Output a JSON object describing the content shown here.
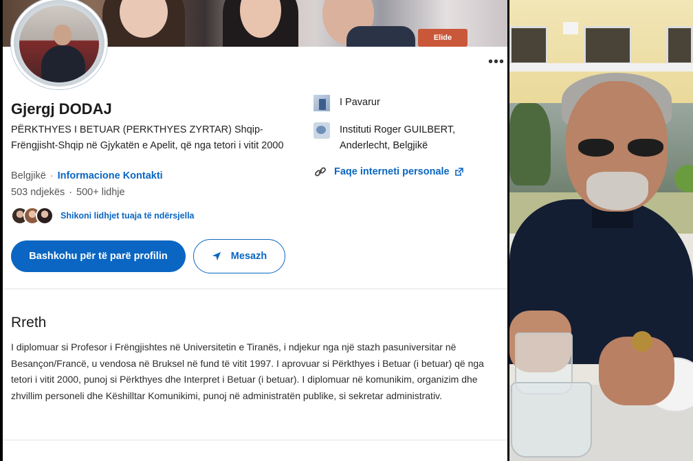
{
  "profile": {
    "name": "Gjergj DODAJ",
    "headline": "PËRKTHYES I BETUAR (PERKTHYES ZYRTAR) Shqip-Frëngjisht-Shqip në Gjykatën e Apelit, që nga tetori i vitit 2000",
    "location": "Belgjikë",
    "contact_link": "Informacione Kontakti",
    "followers": "503 ndjekës",
    "connections": "500+ lidhje",
    "mutual_text": "Shikoni lidhjet tuaja të ndërsjella",
    "more_label": "•••"
  },
  "actions": {
    "join_label": "Bashkohu për të parë profilin",
    "message_label": "Mesazh"
  },
  "cover": {
    "tag": "Elide"
  },
  "side_info": {
    "company": "I Pavarur",
    "school": "Instituti Roger GUILBERT, Anderlecht, Belgjikë",
    "website": "Faqe interneti personale"
  },
  "about": {
    "title": "Rreth",
    "text": "I diplomuar si Profesor i Frëngjishtes në Universitetin e Tiranës, i ndjekur nga një stazh pasuniversitar në Besançon/Francë, u vendosa në Bruksel në fund të vitit 1997. I aprovuar si Përkthyes i Betuar (i betuar) që nga tetori i vitit 2000, punoj si Përkthyes dhe Interpret i Betuar (i betuar). I diplomuar në komunikim, organizim dhe zhvillim personeli dhe Këshilltar Komunikimi, punoj në administratën publike, si sekretar administrativ."
  },
  "colors": {
    "accent": "#0a66c2",
    "text": "#1b1b1b",
    "muted": "#555555"
  },
  "icons": {
    "company": "company-logo-icon",
    "school": "school-logo-icon",
    "link": "link-icon",
    "external": "external-link-icon",
    "send": "send-icon",
    "more": "more-icon"
  }
}
